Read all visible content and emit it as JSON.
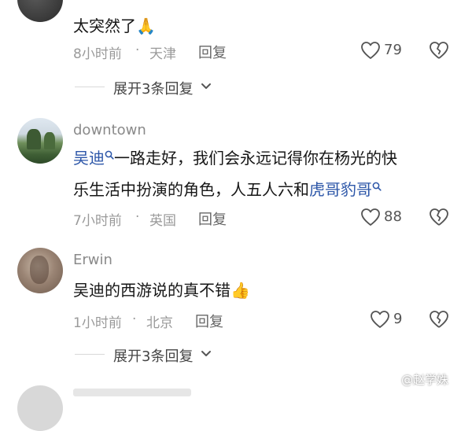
{
  "comments": [
    {
      "text": "太突然了🙏",
      "time": "8小时前",
      "location": "天津",
      "reply_label": "回复",
      "likes": "79",
      "expand": "展开3条回复"
    },
    {
      "username": "downtown",
      "mention1": "吴迪",
      "line1_rest": "一路走好，我们会永远记得你在杨光的快",
      "line2": "乐生活中扮演的角色，人五人六和",
      "mention2": "虎哥豹哥",
      "time": "7小时前",
      "location": "英国",
      "reply_label": "回复",
      "likes": "88"
    },
    {
      "username": "Erwin",
      "text": "吴迪的西游说的真不错👍",
      "time": "1小时前",
      "location": "北京",
      "reply_label": "回复",
      "likes": "9",
      "expand": "展开3条回复"
    }
  ],
  "separator": "·",
  "watermark": "@赵学姝",
  "icons": [
    "heart-icon",
    "broken-heart-icon",
    "chevron-down-icon",
    "search-icon",
    "thumbs-up-icon",
    "folded-hands-icon"
  ]
}
